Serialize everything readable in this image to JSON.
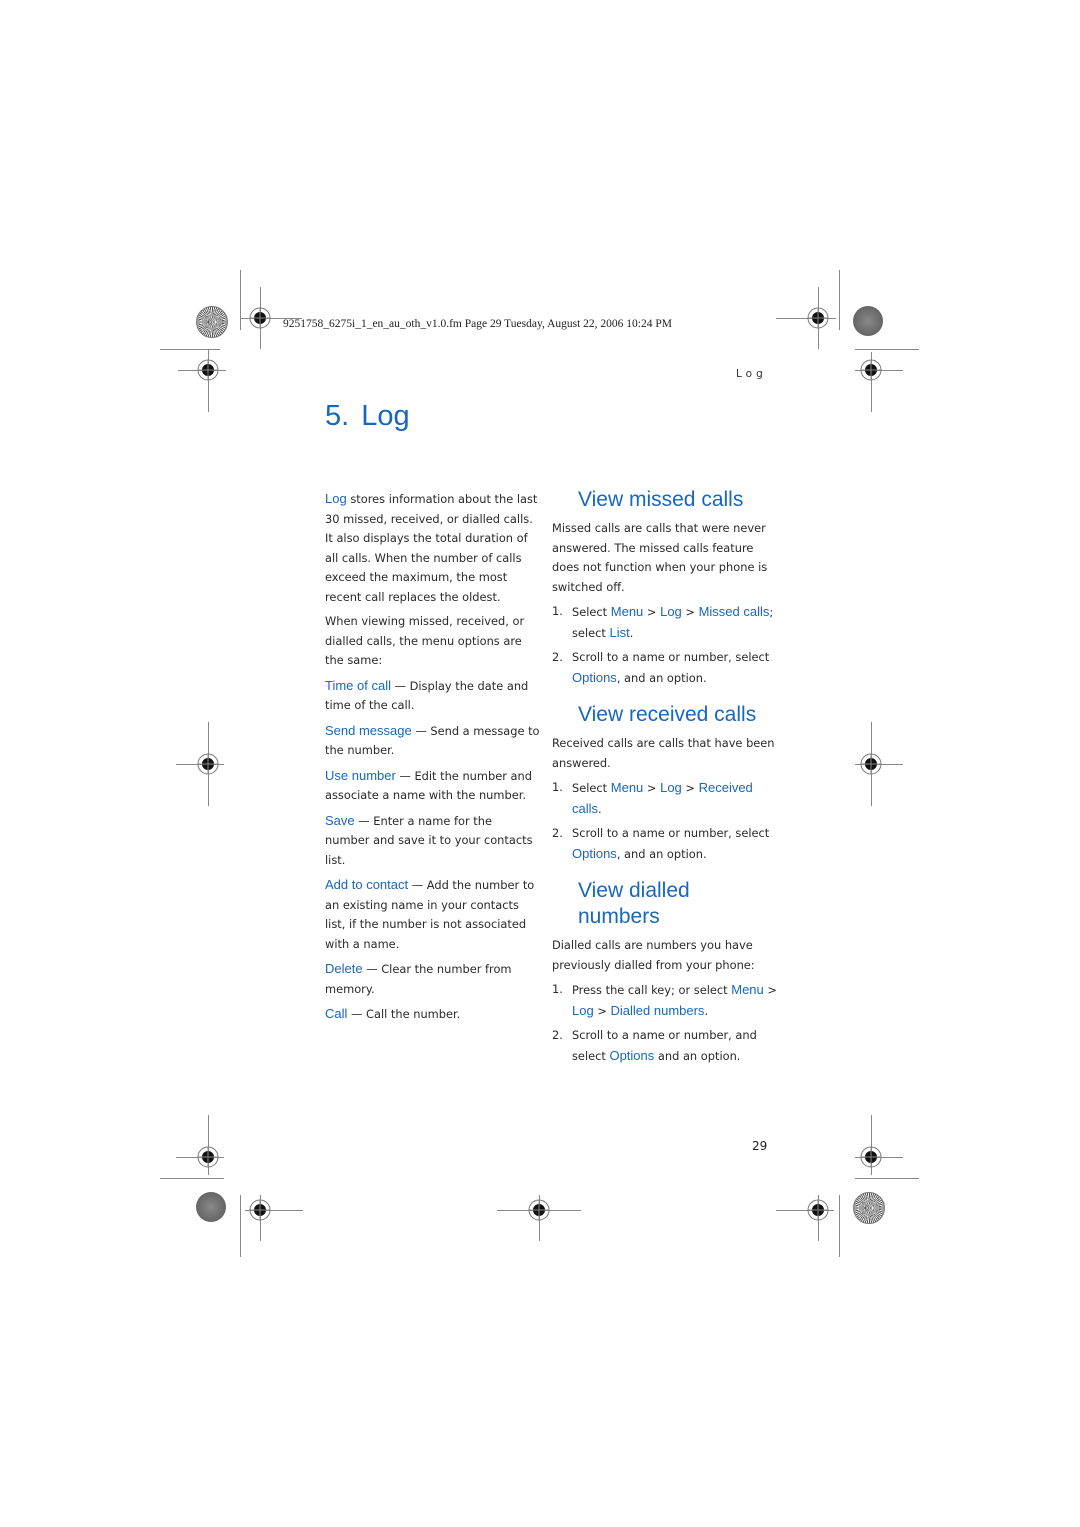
{
  "header": {
    "file_info": "9251758_6275i_1_en_au_oth_v1.0.fm  Page 29  Tuesday, August 22, 2006  10:24 PM",
    "running_head": "Log"
  },
  "chapter": {
    "number": "5.",
    "title": "Log"
  },
  "intro": {
    "p1_term": "Log",
    "p1_text": " stores information about the last 30 missed, received, or dialled calls. It also displays the total duration of all calls. When the number of calls exceed the maximum, the most recent call replaces the oldest.",
    "p2_text": "When viewing missed, received, or dialled calls, the menu options are the same:"
  },
  "options": [
    {
      "term": "Time of call",
      "desc": " — Display the date and time of the call."
    },
    {
      "term": "Send message",
      "desc": " — Send a message to the number."
    },
    {
      "term": "Use number",
      "desc": " — Edit the number and associate a name with the number."
    },
    {
      "term": "Save",
      "desc": " — Enter a name for the number and save it to your contacts list."
    },
    {
      "term": "Add to contact",
      "desc": " — Add the number to an existing name in your contacts list, if the number is not associated with a name."
    },
    {
      "term": "Delete",
      "desc": " — Clear the number from memory."
    },
    {
      "term": "Call",
      "desc": " — Call the number."
    }
  ],
  "sections": {
    "missed": {
      "title": "View missed calls",
      "body": "Missed calls are calls that were never answered. The missed calls feature does not function when your phone is switched off.",
      "step1": {
        "n": "1.",
        "pre": "Select ",
        "menu": "Menu",
        "sep1": " > ",
        "log": "Log",
        "sep2": " > ",
        "item": "Missed calls",
        "mid": "; select ",
        "action": "List",
        "post": "."
      },
      "step2": {
        "n": "2.",
        "pre": "Scroll to a name or number, select ",
        "action": "Options",
        "post": ", and an option."
      }
    },
    "received": {
      "title": "View received calls",
      "body": "Received calls are calls that have been answered.",
      "step1": {
        "n": "1.",
        "pre": "Select ",
        "menu": "Menu",
        "sep1": " > ",
        "log": "Log",
        "sep2": " > ",
        "item": "Received calls",
        "post": "."
      },
      "step2": {
        "n": "2.",
        "pre": "Scroll to a name or number, select ",
        "action": "Options",
        "post": ", and an option."
      }
    },
    "dialled": {
      "title": "View dialled numbers",
      "body": "Dialled calls are numbers you have previously dialled from your phone:",
      "step1": {
        "n": "1.",
        "pre": "Press the call key; or select ",
        "menu": "Menu",
        "sep1": " > ",
        "log": "Log",
        "sep2": " > ",
        "item": "Dialled numbers",
        "post": "."
      },
      "step2": {
        "n": "2.",
        "pre": "Scroll to a name or number, and select ",
        "action": "Options",
        "post": " and an option."
      }
    }
  },
  "footer": {
    "page_number": "29"
  }
}
